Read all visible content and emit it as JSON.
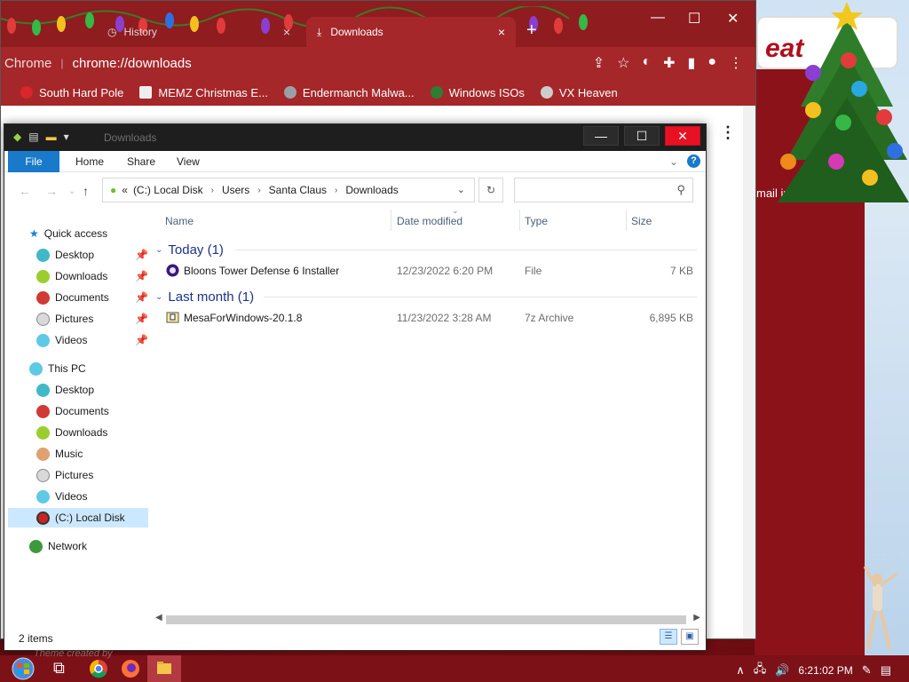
{
  "desktop": {
    "popup_text": "eat",
    "links_text": "mail  images"
  },
  "chrome": {
    "tabs": [
      {
        "label": "History",
        "close": "×"
      },
      {
        "label": "Downloads",
        "close": "×"
      }
    ],
    "new_tab": "+",
    "window_controls": {
      "minimize": "—",
      "maximize": "☐",
      "close": "✕"
    },
    "omnibox": {
      "label": "Chrome",
      "separator": "|",
      "url": "chrome://downloads"
    },
    "toolbar_icons": [
      "share-icon",
      "star-icon",
      "profile-icon",
      "extension-icon",
      "sidepanel-icon",
      "account-icon",
      "menu-icon"
    ],
    "bookmarks": [
      {
        "label": "South Hard Pole",
        "color": "#d8262c"
      },
      {
        "label": "MEMZ Christmas E...",
        "color": "#eeeeee"
      },
      {
        "label": "Endermanch Malwa...",
        "color": "#9aa0a6"
      },
      {
        "label": "Windows ISOs",
        "color": "#2e7d32"
      },
      {
        "label": "VX Heaven",
        "color": "#cccccc"
      }
    ],
    "kebab": "⋮"
  },
  "explorer": {
    "title": "Downloads",
    "ribbon_tabs": [
      "File",
      "Home",
      "Share",
      "View"
    ],
    "address": {
      "root_marker": "«",
      "crumbs": [
        "(C:) Local Disk",
        "Users",
        "Santa Claus",
        "Downloads"
      ],
      "separator": "›"
    },
    "search_placeholder": "",
    "sidebar": {
      "quick_access": "Quick access",
      "quick_items": [
        "Desktop",
        "Downloads",
        "Documents",
        "Pictures",
        "Videos"
      ],
      "this_pc": "This PC",
      "pc_items": [
        "Desktop",
        "Documents",
        "Downloads",
        "Music",
        "Pictures",
        "Videos",
        "(C:) Local Disk"
      ],
      "network": "Network",
      "selected": "(C:) Local Disk"
    },
    "columns": [
      "Name",
      "Date modified",
      "Type",
      "Size"
    ],
    "groups": [
      {
        "header": "Today (1)",
        "files": [
          {
            "name": "Bloons Tower Defense 6 Installer",
            "date": "12/23/2022 6:20 PM",
            "type": "File",
            "size": "7 KB"
          }
        ]
      },
      {
        "header": "Last month (1)",
        "files": [
          {
            "name": "MesaForWindows-20.1.8",
            "date": "11/23/2022 3:28 AM",
            "type": "7z Archive",
            "size": "6,895 KB"
          }
        ]
      }
    ],
    "status": "2 items",
    "buttons": {
      "minimize": "—",
      "maximize": "☐",
      "close": "✕"
    }
  },
  "taskbar": {
    "credit": "Theme created by",
    "time": "6:21:02 PM"
  },
  "colors": {
    "accent": "#1979ca",
    "chrome_frame": "#a52729",
    "desktop": "#8c121a"
  }
}
